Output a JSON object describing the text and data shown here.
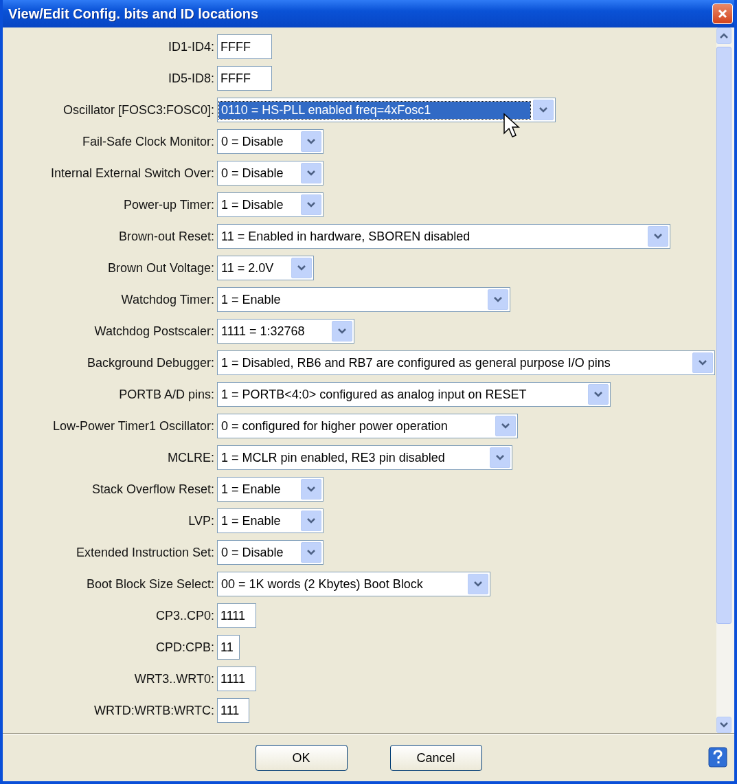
{
  "window": {
    "title": "View/Edit Config. bits and ID locations"
  },
  "fields": [
    {
      "kind": "text",
      "label": "ID1-ID4:",
      "value": "FFFF"
    },
    {
      "kind": "text",
      "label": "ID5-ID8:",
      "value": "FFFF"
    },
    {
      "kind": "select",
      "label": "Oscillator [FOSC3:FOSC0]:",
      "value": "0110 = HS-PLL enabled freq=4xFosc1",
      "focused": true
    },
    {
      "kind": "select",
      "label": "Fail-Safe Clock Monitor:",
      "value": "0 = Disable",
      "focused": false
    },
    {
      "kind": "select",
      "label": "Internal External Switch Over:",
      "value": "0 = Disable",
      "focused": false
    },
    {
      "kind": "select",
      "label": "Power-up Timer:",
      "value": "1 = Disable",
      "focused": false
    },
    {
      "kind": "select",
      "label": "Brown-out Reset:",
      "value": "11 = Enabled in hardware, SBOREN disabled",
      "focused": false
    },
    {
      "kind": "select",
      "label": "Brown Out Voltage:",
      "value": "11 = 2.0V",
      "focused": false
    },
    {
      "kind": "select",
      "label": "Watchdog Timer:",
      "value": "1 = Enable",
      "focused": false
    },
    {
      "kind": "select",
      "label": "Watchdog Postscaler:",
      "value": "1111 = 1:32768",
      "focused": false
    },
    {
      "kind": "select",
      "label": "Background Debugger:",
      "value": "1 = Disabled, RB6 and RB7 are configured as general purpose I/O pins",
      "focused": false
    },
    {
      "kind": "select",
      "label": "PORTB A/D pins:",
      "value": "1 = PORTB<4:0> configured as analog input on RESET",
      "focused": false
    },
    {
      "kind": "select",
      "label": "Low-Power Timer1 Oscillator:",
      "value": "0 = configured for higher power operation",
      "focused": false
    },
    {
      "kind": "select",
      "label": "MCLRE:",
      "value": "1 = MCLR pin enabled, RE3 pin disabled",
      "focused": false
    },
    {
      "kind": "select",
      "label": "Stack Overflow Reset:",
      "value": "1 = Enable",
      "focused": false
    },
    {
      "kind": "select",
      "label": "LVP:",
      "value": "1 = Enable",
      "focused": false
    },
    {
      "kind": "select",
      "label": "Extended Instruction Set:",
      "value": "0 = Disable",
      "focused": false
    },
    {
      "kind": "select",
      "label": "Boot Block Size Select:",
      "value": "00 = 1K words (2 Kbytes) Boot Block",
      "focused": false
    },
    {
      "kind": "text",
      "label": "CP3..CP0:",
      "value": "1111"
    },
    {
      "kind": "text",
      "label": "CPD:CPB:",
      "value": "11"
    },
    {
      "kind": "text",
      "label": "WRT3..WRT0:",
      "value": "1111"
    },
    {
      "kind": "text",
      "label": "WRTD:WRTB:WRTC:",
      "value": "111"
    }
  ],
  "buttons": [
    "OK",
    "Cancel"
  ]
}
